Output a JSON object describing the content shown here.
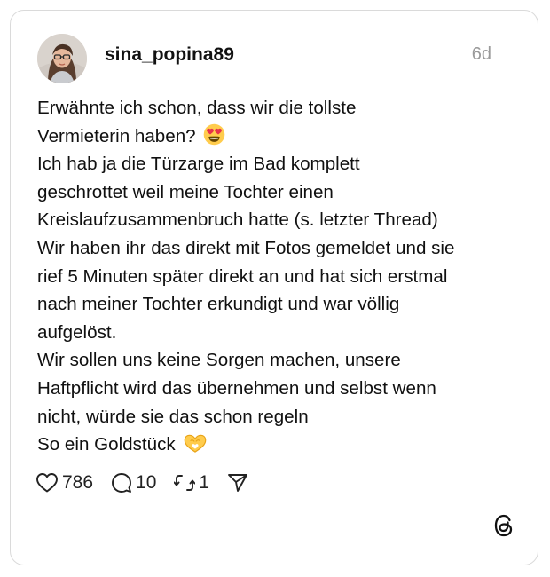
{
  "post": {
    "username": "sina_popina89",
    "time": "6d",
    "lines": [
      "Erwähnte ich schon, dass wir die tollste",
      "Vermieterin haben?",
      "Ich hab ja die Türzarge im Bad komplett",
      "geschrottet weil meine Tochter einen",
      "Kreislaufzusammenbruch hatte (s. letzter Thread)",
      "Wir haben ihr das direkt mit Fotos gemeldet und sie",
      "rief 5 Minuten später direkt an und hat sich erstmal",
      "nach meiner Tochter erkundigt und war völlig",
      "aufgelöst.",
      "Wir sollen uns keine Sorgen machen, unsere",
      "Haftpflicht wird das übernehmen und selbst wenn",
      "nicht, würde sie das schon regeln",
      "So ein Goldstück"
    ],
    "emojis": [
      "heart-eyes-emoji",
      "heart-hands-emoji"
    ]
  },
  "actions": {
    "likes": "786",
    "replies": "10",
    "reposts": "1"
  },
  "icons": [
    "avatar",
    "heart-icon",
    "comment-icon",
    "repost-icon",
    "share-icon",
    "threads-logo-icon"
  ],
  "colors": {
    "text": "#101010",
    "muted": "#9a9a9a",
    "border": "#dadada",
    "emoji_face": "#ffcc4d",
    "emoji_heart": "#e8324a"
  }
}
